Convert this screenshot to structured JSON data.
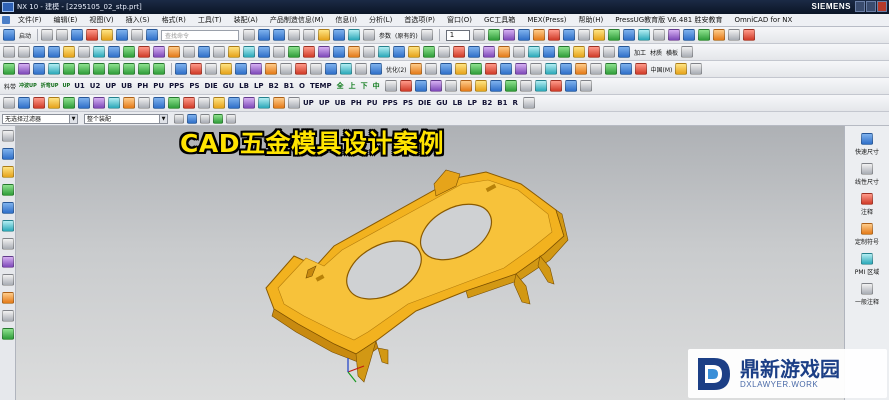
{
  "window": {
    "title": "NX 10 - 建模 - [2295105_02_stp.prt]",
    "brand": "SIEMENS"
  },
  "menu": [
    "文件(F)",
    "编辑(E)",
    "视图(V)",
    "插入(S)",
    "格式(R)",
    "工具(T)",
    "装配(A)",
    "产品制造信息(M)",
    "信息(I)",
    "分析(L)",
    "首选项(P)",
    "窗口(O)",
    "GC工具箱",
    "MEX(Press)",
    "帮助(H)",
    "PressUG教育版 V6.481 胜安教育",
    "OmniCAD for NX"
  ],
  "toolbar": {
    "start_label": "启动",
    "search_placeholder": "查找命令",
    "params_label": "参数",
    "original_label": "(原有的)",
    "layer_value": "1",
    "optimize_label": "优化(2)",
    "right_labels": [
      "加工",
      "材质",
      "横板",
      "中国(M)"
    ],
    "material_label": "料带",
    "mini_labels": [
      "冲波UP",
      "折弯UP",
      "UP"
    ],
    "plate_buttons": [
      "U1",
      "U2",
      "UP",
      "UB",
      "PH",
      "PU",
      "PPS",
      "PS",
      "DIE",
      "GU",
      "LB",
      "LP",
      "B2",
      "B1",
      "O",
      "TEMP",
      "全",
      "上",
      "下",
      "中"
    ],
    "plate_buttons_2": [
      "UP",
      "UP",
      "UB",
      "PH",
      "PU",
      "PPS",
      "PS",
      "DIE",
      "GU",
      "LB",
      "LP",
      "B2",
      "B1",
      "R"
    ]
  },
  "filter": {
    "selection_filter": "无选择过滤器",
    "assembly_scope": "整个装配"
  },
  "viewport": {
    "overlay_title": "CAD五金模具设计案例"
  },
  "right_panel": [
    {
      "label": "快速尺寸",
      "icon": "quick-dimension-icon"
    },
    {
      "label": "线性尺寸",
      "icon": "linear-dimension-icon"
    },
    {
      "label": "注释",
      "icon": "note-icon"
    },
    {
      "label": "定制符号",
      "icon": "custom-symbol-icon"
    },
    {
      "label": "PMI 区域",
      "icon": "pmi-region-icon"
    },
    {
      "label": "一般注释",
      "icon": "general-note-icon"
    }
  ],
  "watermark": {
    "title": "鼎新游戏园",
    "subtitle": "DXLAWYER.WORK"
  },
  "colors": {
    "title_bar": "#0b1526",
    "part_yellow": "#f2b21f",
    "overlay_text": "#ffe400",
    "watermark_blue": "#1c3f86"
  }
}
